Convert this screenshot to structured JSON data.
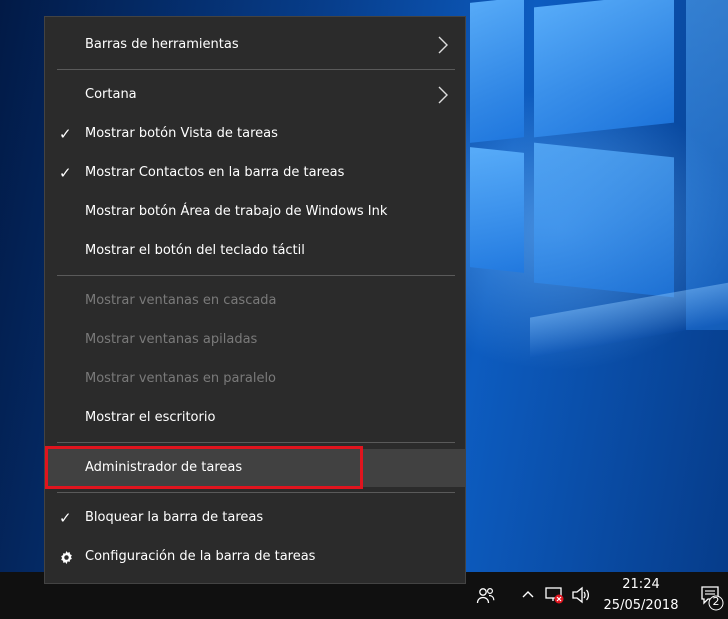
{
  "menu": {
    "items": [
      {
        "label": "Barras de herramientas",
        "submenu": true,
        "checked": false,
        "enabled": true
      },
      {
        "label": "Cortana",
        "submenu": true,
        "checked": false,
        "enabled": true
      },
      {
        "label": "Mostrar botón Vista de tareas",
        "submenu": false,
        "checked": true,
        "enabled": true
      },
      {
        "label": "Mostrar Contactos en la barra de tareas",
        "submenu": false,
        "checked": true,
        "enabled": true
      },
      {
        "label": "Mostrar botón Área de trabajo de Windows Ink",
        "submenu": false,
        "checked": false,
        "enabled": true
      },
      {
        "label": "Mostrar el botón del teclado táctil",
        "submenu": false,
        "checked": false,
        "enabled": true
      },
      {
        "label": "Mostrar ventanas en cascada",
        "submenu": false,
        "checked": false,
        "enabled": false
      },
      {
        "label": "Mostrar ventanas apiladas",
        "submenu": false,
        "checked": false,
        "enabled": false
      },
      {
        "label": "Mostrar ventanas en paralelo",
        "submenu": false,
        "checked": false,
        "enabled": false
      },
      {
        "label": "Mostrar el escritorio",
        "submenu": false,
        "checked": false,
        "enabled": true
      },
      {
        "label": "Administrador de tareas",
        "submenu": false,
        "checked": false,
        "enabled": true,
        "highlighted": true
      },
      {
        "label": "Bloquear la barra de tareas",
        "submenu": false,
        "checked": true,
        "enabled": true
      },
      {
        "label": "Configuración de la barra de tareas",
        "submenu": false,
        "checked": false,
        "enabled": true,
        "icon": "gear-icon"
      }
    ],
    "highlight_color": "#e0141e"
  },
  "taskbar": {
    "time": "21:24",
    "date": "25/05/2018",
    "notification_count": "2",
    "tray_icons": [
      "people-icon",
      "chevron-up-icon",
      "network-error-icon",
      "volume-icon",
      "action-center-icon"
    ]
  }
}
